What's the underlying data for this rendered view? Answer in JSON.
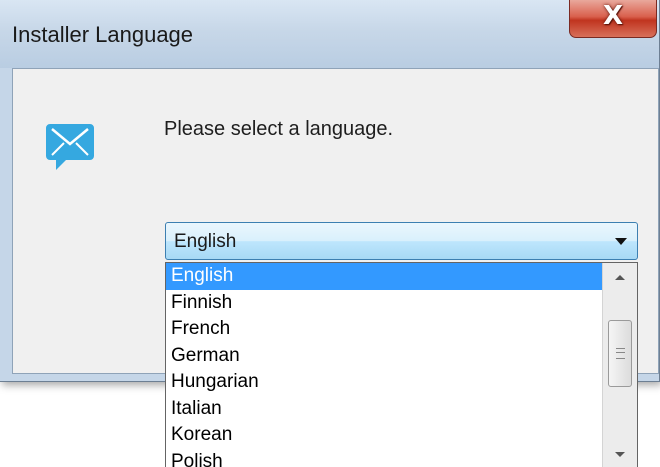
{
  "window": {
    "title": "Installer Language",
    "close_label": "X",
    "icon": "envelope-speech-bubble-icon",
    "accent_color": "#35a8e0"
  },
  "dialog": {
    "prompt": "Please select a language."
  },
  "language_select": {
    "selected": "English",
    "options": [
      "English",
      "Finnish",
      "French",
      "German",
      "Hungarian",
      "Italian",
      "Korean",
      "Polish"
    ],
    "highlighted_index": 0,
    "highlight_color": "#3399ff"
  },
  "scrollbar": {
    "up_icon": "scroll-up-arrow-icon",
    "down_icon": "scroll-down-arrow-icon"
  }
}
